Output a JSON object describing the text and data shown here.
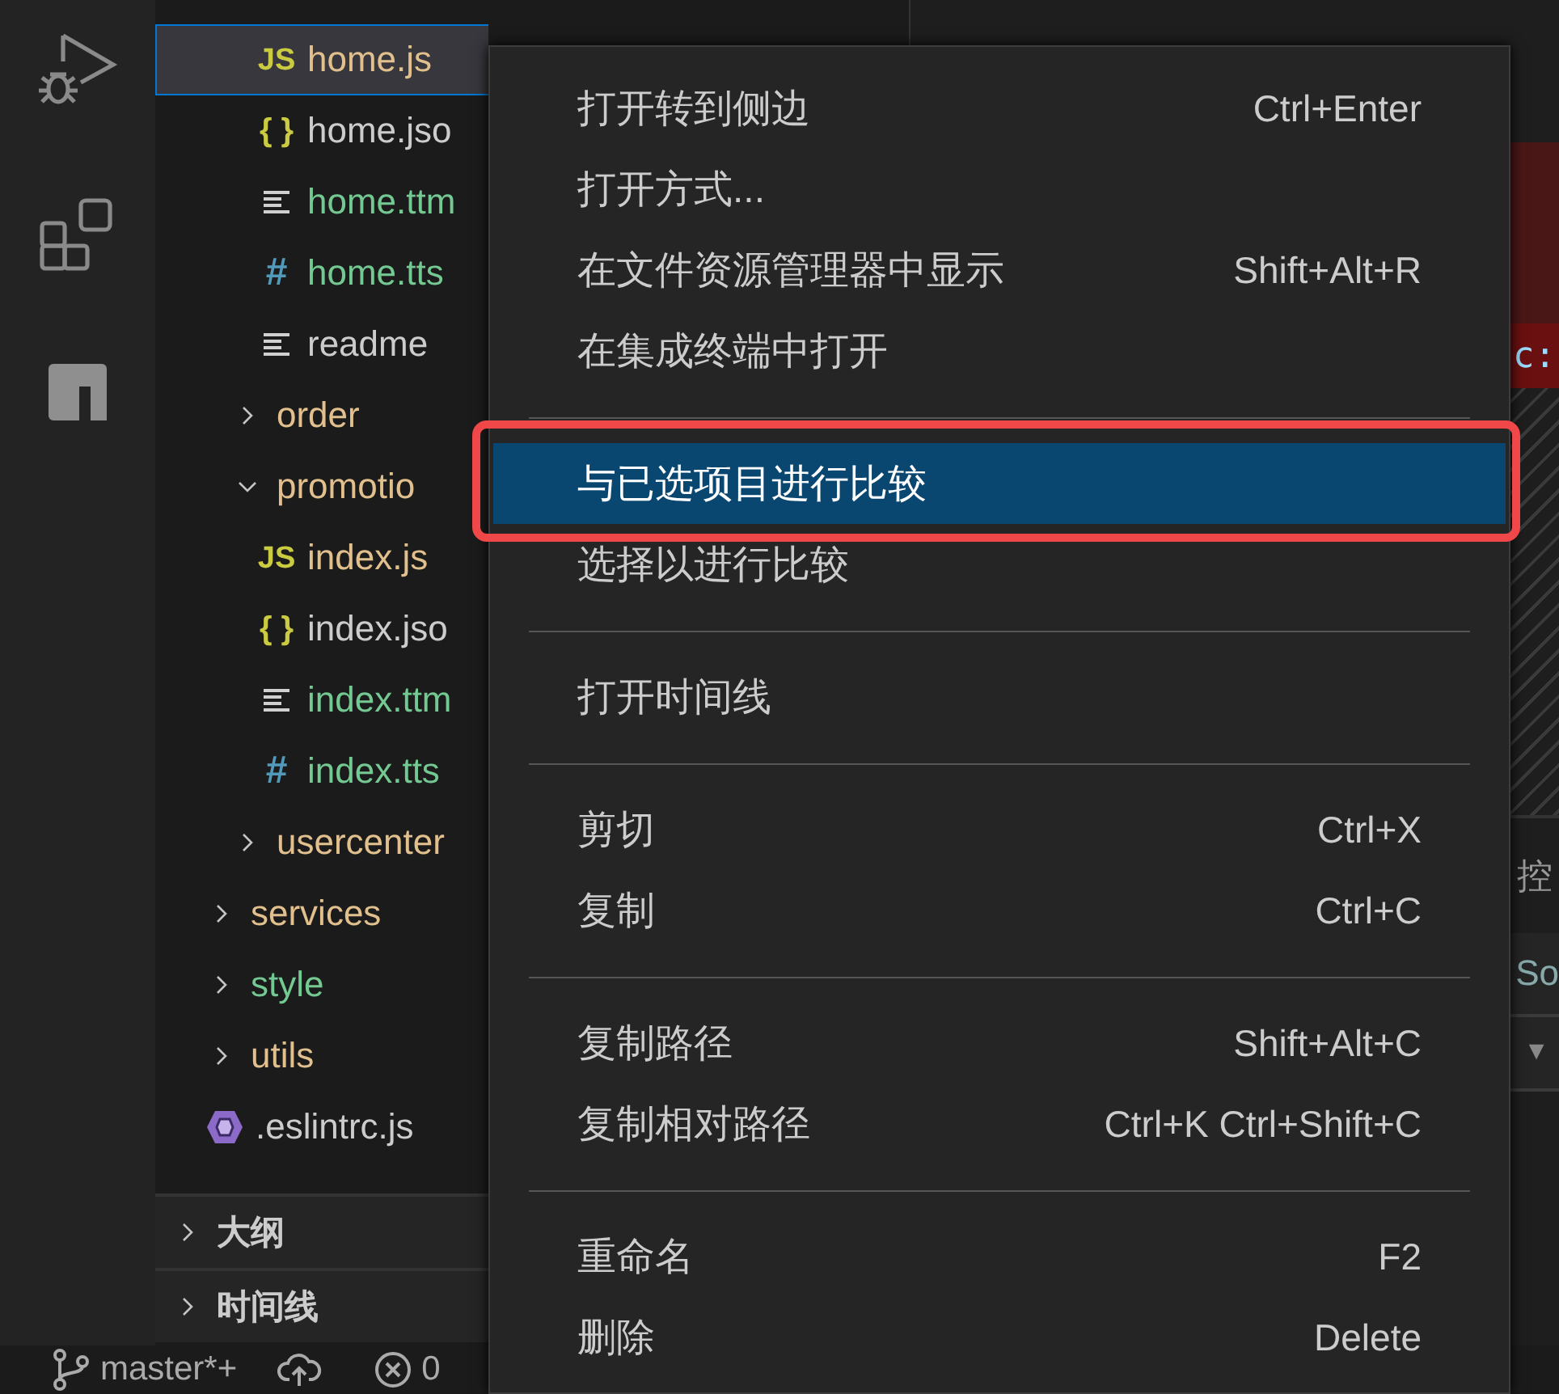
{
  "explorer": {
    "tree": [
      {
        "kind": "offscreen",
        "children": [
          {
            "kind": "offscreen",
            "children": [
              {
                "kind": "js",
                "glyph": "JS",
                "name": "home.js",
                "color": "#e2c08d",
                "selected": true
              },
              {
                "kind": "json",
                "glyph": "{ }",
                "name": "home.jso",
                "color": "#cccccc",
                "selected": false
              },
              {
                "kind": "ttml",
                "name": "home.ttm",
                "color": "#73c991",
                "selected": false
              },
              {
                "kind": "ttss",
                "glyph": "#",
                "name": "home.tts",
                "color": "#73c991",
                "selected": false
              },
              {
                "kind": "text",
                "name": "readme",
                "color": "#cccccc",
                "selected": false
              }
            ]
          },
          {
            "kind": "folder",
            "name": "order",
            "color": "#e2c08d",
            "expanded": false,
            "selected": false
          },
          {
            "kind": "folder",
            "name": "promotio",
            "color": "#e2c08d",
            "expanded": true,
            "selected": false,
            "children": [
              {
                "kind": "js",
                "glyph": "JS",
                "name": "index.js",
                "color": "#e2c08d",
                "selected": false
              },
              {
                "kind": "json",
                "glyph": "{ }",
                "name": "index.jso",
                "color": "#cccccc",
                "selected": false
              },
              {
                "kind": "ttml",
                "name": "index.ttm",
                "color": "#73c991",
                "selected": false
              },
              {
                "kind": "ttss",
                "glyph": "#",
                "name": "index.tts",
                "color": "#73c991",
                "selected": false
              }
            ]
          },
          {
            "kind": "folder",
            "name": "usercenter",
            "color": "#e2c08d",
            "expanded": false,
            "selected": false
          }
        ]
      },
      {
        "kind": "folder",
        "name": "services",
        "color": "#e2c08d",
        "expanded": false,
        "selected": false
      },
      {
        "kind": "folder",
        "name": "style",
        "color": "#73c991",
        "expanded": false,
        "selected": false
      },
      {
        "kind": "folder",
        "name": "utils",
        "color": "#e2c08d",
        "expanded": false,
        "selected": false
      },
      {
        "kind": "eslint",
        "name": ".eslintrc.js",
        "color": "#cccccc",
        "selected": false
      }
    ],
    "sections": [
      {
        "title": "大纲",
        "expanded": false
      },
      {
        "title": "时间线",
        "expanded": false
      }
    ]
  },
  "editor": {
    "code_fragment": "c:",
    "panel_tab_fragment": "控",
    "panel_field_fragment": "So",
    "dropdown_glyph": "▼"
  },
  "status_bar": {
    "branch": "master*+",
    "errors": "0"
  },
  "context_menu": {
    "groups": [
      [
        {
          "label": "打开转到侧边",
          "shortcut": "Ctrl+Enter",
          "selected": false,
          "highlighted": false
        },
        {
          "label": "打开方式...",
          "selected": false,
          "highlighted": false
        },
        {
          "label": "在文件资源管理器中显示",
          "shortcut": "Shift+Alt+R",
          "selected": false,
          "highlighted": false
        },
        {
          "label": "在集成终端中打开",
          "selected": false,
          "highlighted": false
        }
      ],
      [
        {
          "label": "与已选项目进行比较",
          "selected": true,
          "highlighted": true
        },
        {
          "label": "选择以进行比较",
          "selected": false,
          "highlighted": false
        }
      ],
      [
        {
          "label": "打开时间线",
          "selected": false,
          "highlighted": false
        }
      ],
      [
        {
          "label": "剪切",
          "shortcut": "Ctrl+X",
          "selected": false,
          "highlighted": false
        },
        {
          "label": "复制",
          "shortcut": "Ctrl+C",
          "selected": false,
          "highlighted": false
        }
      ],
      [
        {
          "label": "复制路径",
          "shortcut": "Shift+Alt+C",
          "selected": false,
          "highlighted": false
        },
        {
          "label": "复制相对路径",
          "shortcut": "Ctrl+K Ctrl+Shift+C",
          "selected": false,
          "highlighted": false
        }
      ],
      [
        {
          "label": "重命名",
          "shortcut": "F2",
          "selected": false,
          "highlighted": false
        },
        {
          "label": "删除",
          "shortcut": "Delete",
          "selected": false,
          "highlighted": false
        }
      ]
    ]
  }
}
